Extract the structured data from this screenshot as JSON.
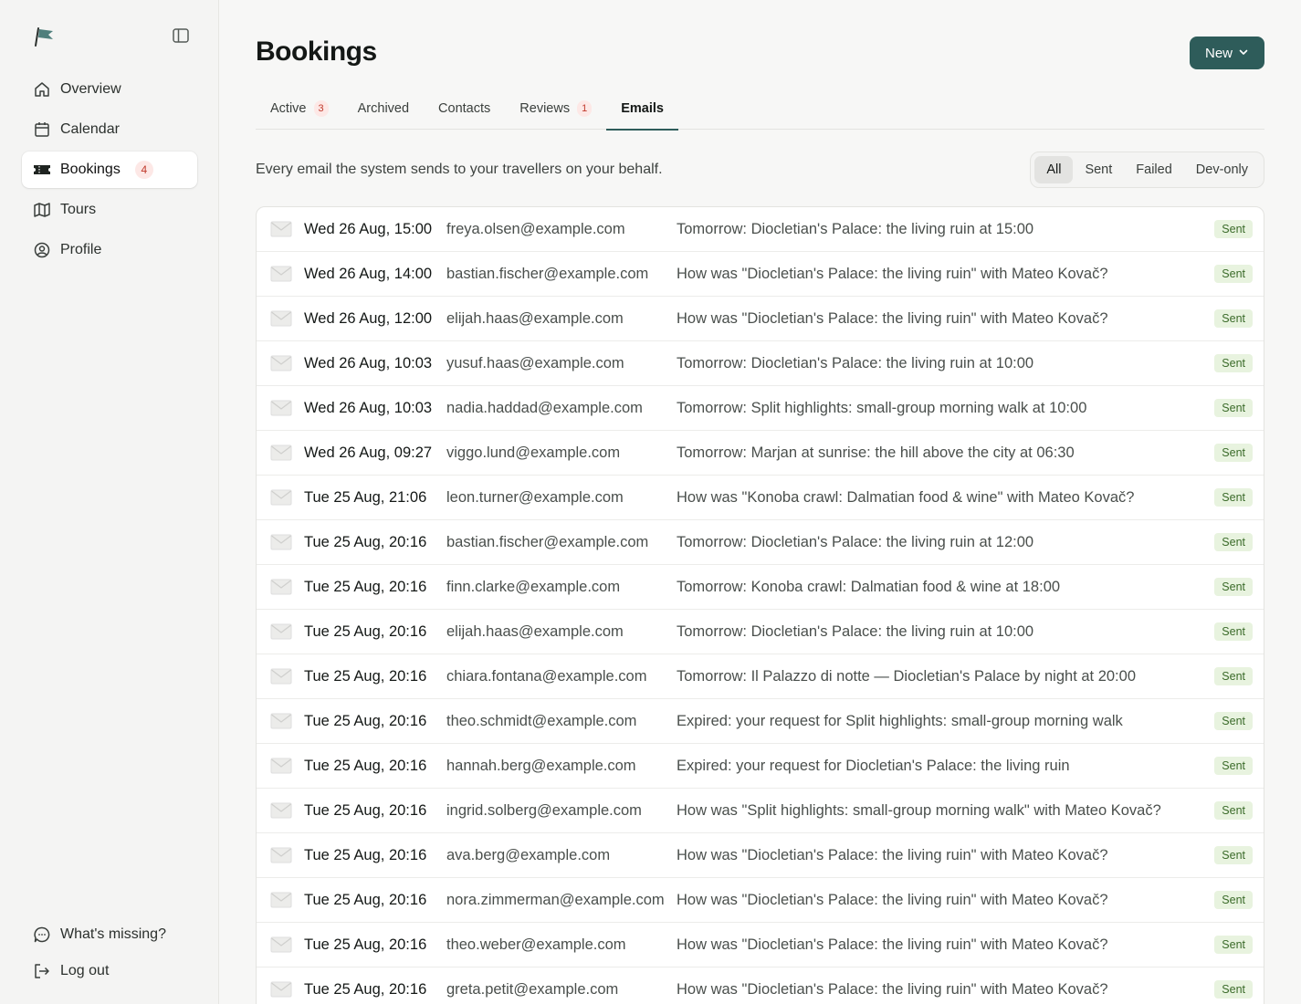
{
  "sidebar": {
    "nav": [
      {
        "label": "Overview",
        "icon": "home-icon"
      },
      {
        "label": "Calendar",
        "icon": "calendar-icon"
      },
      {
        "label": "Bookings",
        "icon": "ticket-icon",
        "badge": "4"
      },
      {
        "label": "Tours",
        "icon": "map-icon"
      },
      {
        "label": "Profile",
        "icon": "user-circle-icon"
      }
    ],
    "bottom": [
      {
        "label": "What's missing?",
        "icon": "chat-icon"
      },
      {
        "label": "Log out",
        "icon": "logout-icon"
      }
    ]
  },
  "header": {
    "title": "Bookings",
    "new_label": "New"
  },
  "tabs": [
    {
      "label": "Active",
      "badge": "3"
    },
    {
      "label": "Archived"
    },
    {
      "label": "Contacts"
    },
    {
      "label": "Reviews",
      "badge": "1"
    },
    {
      "label": "Emails"
    }
  ],
  "emails": {
    "description": "Every email the system sends to your travellers on your behalf.",
    "filters": [
      "All",
      "Sent",
      "Failed",
      "Dev-only"
    ],
    "rows": [
      {
        "when": "Wed 26 Aug, 15:00",
        "to": "freya.olsen@example.com",
        "subject": "Tomorrow: Diocletian's Palace: the living ruin at 15:00",
        "status": "Sent"
      },
      {
        "when": "Wed 26 Aug, 14:00",
        "to": "bastian.fischer@example.com",
        "subject": "How was \"Diocletian's Palace: the living ruin\" with Mateo Kovač?",
        "status": "Sent"
      },
      {
        "when": "Wed 26 Aug, 12:00",
        "to": "elijah.haas@example.com",
        "subject": "How was \"Diocletian's Palace: the living ruin\" with Mateo Kovač?",
        "status": "Sent"
      },
      {
        "when": "Wed 26 Aug, 10:03",
        "to": "yusuf.haas@example.com",
        "subject": "Tomorrow: Diocletian's Palace: the living ruin at 10:00",
        "status": "Sent"
      },
      {
        "when": "Wed 26 Aug, 10:03",
        "to": "nadia.haddad@example.com",
        "subject": "Tomorrow: Split highlights: small-group morning walk at 10:00",
        "status": "Sent"
      },
      {
        "when": "Wed 26 Aug, 09:27",
        "to": "viggo.lund@example.com",
        "subject": "Tomorrow: Marjan at sunrise: the hill above the city at 06:30",
        "status": "Sent"
      },
      {
        "when": "Tue 25 Aug, 21:06",
        "to": "leon.turner@example.com",
        "subject": "How was \"Konoba crawl: Dalmatian food & wine\" with Mateo Kovač?",
        "status": "Sent"
      },
      {
        "when": "Tue 25 Aug, 20:16",
        "to": "bastian.fischer@example.com",
        "subject": "Tomorrow: Diocletian's Palace: the living ruin at 12:00",
        "status": "Sent"
      },
      {
        "when": "Tue 25 Aug, 20:16",
        "to": "finn.clarke@example.com",
        "subject": "Tomorrow: Konoba crawl: Dalmatian food & wine at 18:00",
        "status": "Sent"
      },
      {
        "when": "Tue 25 Aug, 20:16",
        "to": "elijah.haas@example.com",
        "subject": "Tomorrow: Diocletian's Palace: the living ruin at 10:00",
        "status": "Sent"
      },
      {
        "when": "Tue 25 Aug, 20:16",
        "to": "chiara.fontana@example.com",
        "subject": "Tomorrow: Il Palazzo di notte — Diocletian's Palace by night at 20:00",
        "status": "Sent"
      },
      {
        "when": "Tue 25 Aug, 20:16",
        "to": "theo.schmidt@example.com",
        "subject": "Expired: your request for Split highlights: small-group morning walk",
        "status": "Sent"
      },
      {
        "when": "Tue 25 Aug, 20:16",
        "to": "hannah.berg@example.com",
        "subject": "Expired: your request for Diocletian's Palace: the living ruin",
        "status": "Sent"
      },
      {
        "when": "Tue 25 Aug, 20:16",
        "to": "ingrid.solberg@example.com",
        "subject": "How was \"Split highlights: small-group morning walk\" with Mateo Kovač?",
        "status": "Sent"
      },
      {
        "when": "Tue 25 Aug, 20:16",
        "to": "ava.berg@example.com",
        "subject": "How was \"Diocletian's Palace: the living ruin\" with Mateo Kovač?",
        "status": "Sent"
      },
      {
        "when": "Tue 25 Aug, 20:16",
        "to": "nora.zimmerman@example.com",
        "subject": "How was \"Diocletian's Palace: the living ruin\" with Mateo Kovač?",
        "status": "Sent"
      },
      {
        "when": "Tue 25 Aug, 20:16",
        "to": "theo.weber@example.com",
        "subject": "How was \"Diocletian's Palace: the living ruin\" with Mateo Kovač?",
        "status": "Sent"
      },
      {
        "when": "Tue 25 Aug, 20:16",
        "to": "greta.petit@example.com",
        "subject": "How was \"Diocletian's Palace: the living ruin\" with Mateo Kovač?",
        "status": "Sent"
      }
    ]
  },
  "colors": {
    "accent": "#2e5c5a",
    "badge_bg": "#fde8e6",
    "badge_text": "#c0392b",
    "status_sent_bg": "#e8f3df",
    "status_sent_text": "#3b6b2a"
  }
}
